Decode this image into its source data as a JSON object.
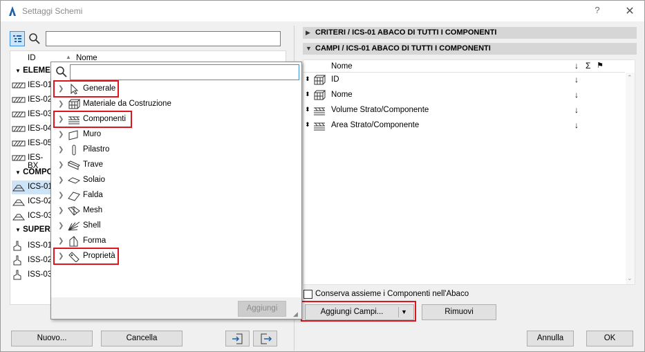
{
  "window": {
    "title": "Settaggi Schemi",
    "help": "?",
    "close": "✕"
  },
  "left": {
    "headers": {
      "id": "ID",
      "name": "Nome"
    },
    "groups": [
      {
        "label": "ELEME",
        "items": [
          "IES-01",
          "IES-02",
          "IES-03",
          "IES-04",
          "IES-05",
          "IES-BX"
        ]
      },
      {
        "label": "COMPO",
        "items": [
          "ICS-01",
          "ICS-02",
          "ICS-03"
        ]
      },
      {
        "label": "SUPER",
        "items": [
          "ISS-01",
          "ISS-02",
          "ISS-03"
        ]
      }
    ]
  },
  "popup": {
    "search_value": "",
    "items": [
      "Generale",
      "Materiale da Costruzione",
      "Componenti",
      "Muro",
      "Pilastro",
      "Trave",
      "Solaio",
      "Falda",
      "Mesh",
      "Shell",
      "Forma",
      "Proprietà"
    ],
    "add_button": "Aggiungi"
  },
  "right": {
    "section1": "CRITERI / ICS-01 ABACO DI TUTTI I COMPONENTI",
    "section2": "CAMPI / ICS-01 ABACO DI TUTTI I COMPONENTI",
    "table_header": {
      "name": "Nome",
      "sort": "↓",
      "sum": "Σ",
      "flag": "⚑"
    },
    "fields": [
      "ID",
      "Nome",
      "Volume Strato/Componente",
      "Area Strato/Componente"
    ],
    "sort_arrow": "↓",
    "keep_label": "Conserva assieme i Componenti nell'Abaco",
    "add_fields": "Aggiungi Campi...",
    "remove": "Rimuovi"
  },
  "footer": {
    "new": "Nuovo...",
    "delete": "Cancella",
    "cancel": "Annulla",
    "ok": "OK"
  }
}
